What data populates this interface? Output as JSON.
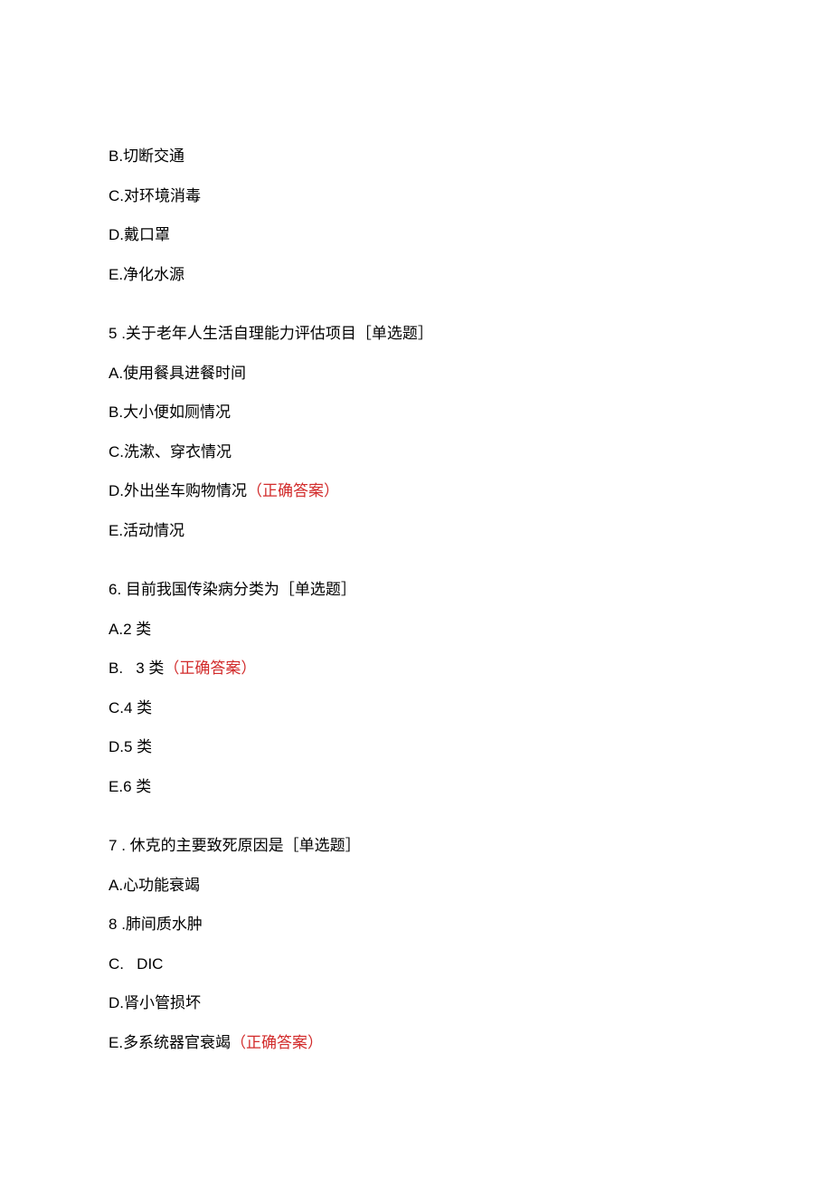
{
  "correctAnswerLabel": "（正确答案）",
  "questions": [
    {
      "isPartial": true,
      "options": [
        {
          "label": "B.",
          "text": "切断交通"
        },
        {
          "label": "C.",
          "text": "对环境消毒"
        },
        {
          "label": "D.",
          "text": "戴口罩"
        },
        {
          "label": "E.",
          "text": "净化水源"
        }
      ]
    },
    {
      "number": "5",
      "separator": " .",
      "text": "关于老年人生活自理能力评估项目［单选题］",
      "options": [
        {
          "label": "A.",
          "text": "使用餐具进餐时间"
        },
        {
          "label": "B.",
          "text": "大小便如厕情况"
        },
        {
          "label": "C.",
          "text": "洗漱、穿衣情况"
        },
        {
          "label": "D.",
          "text": "外出坐车购物情况",
          "correct": true
        },
        {
          "label": "E.",
          "text": "活动情况"
        }
      ]
    },
    {
      "number": "6.",
      "separator": " ",
      "text": "目前我国传染病分类为［单选题］",
      "options": [
        {
          "label": "A.",
          "text": "2 类"
        },
        {
          "label": "B.",
          "spaced": true,
          "text": "3 类",
          "correct": true
        },
        {
          "label": "C.",
          "text": "4 类"
        },
        {
          "label": "D.",
          "text": "5 类"
        },
        {
          "label": "E.",
          "text": "6 类"
        }
      ]
    },
    {
      "number": "7",
      "separator": " . ",
      "text": "休克的主要致死原因是［单选题］",
      "options": [
        {
          "label": "A.",
          "text": "心功能衰竭"
        },
        {
          "label": "8",
          "separator": " .",
          "text": "肺间质水肿"
        },
        {
          "label": "C.",
          "spaced": true,
          "text": "DIC"
        },
        {
          "label": "D.",
          "text": "肾小管损坏"
        },
        {
          "label": "E.",
          "text": "多系统器官衰竭",
          "correct": true
        }
      ]
    }
  ]
}
